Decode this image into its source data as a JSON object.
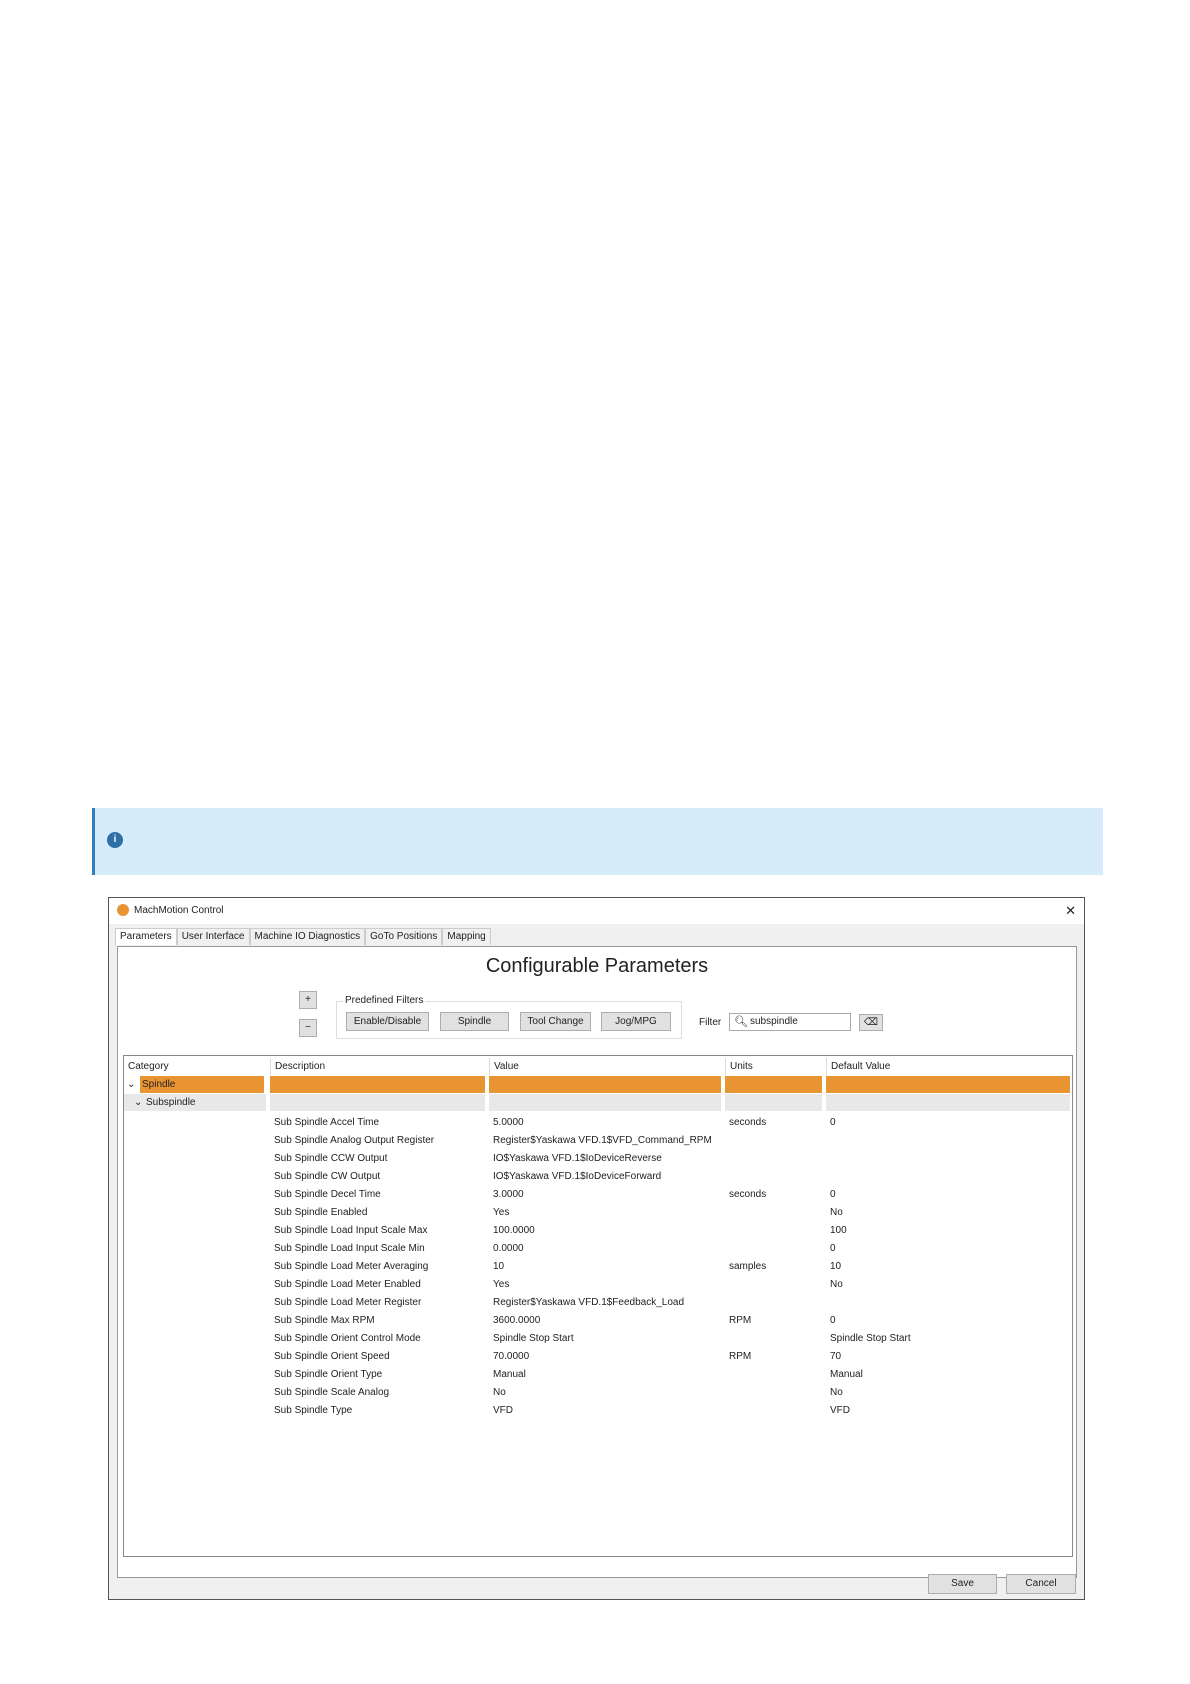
{
  "note": {
    "icon": "info-icon"
  },
  "window": {
    "title": "MachMotion Control",
    "close": "✕",
    "tabs": [
      "Parameters",
      "User Interface",
      "Machine IO Diagnostics",
      "GoTo Positions",
      "Mapping"
    ],
    "heading": "Configurable Parameters",
    "expand": "+",
    "collapse": "−",
    "filters_label": "Predefined Filters",
    "filters": [
      "Enable/Disable",
      "Spindle",
      "Tool Change",
      "Jog/MPG"
    ],
    "filter_label": "Filter",
    "filter_value": "subspindle",
    "columns": [
      "Category",
      "Description",
      "Value",
      "Units",
      "Default Value"
    ],
    "tree": {
      "category": "Spindle",
      "subcategory": "Subspindle"
    },
    "rows": [
      [
        "Sub Spindle Accel Time",
        "5.0000",
        "seconds",
        "0"
      ],
      [
        "Sub Spindle Analog Output Register",
        "Register$Yaskawa VFD.1$VFD_Command_RPM",
        "",
        ""
      ],
      [
        "Sub Spindle CCW Output",
        "IO$Yaskawa VFD.1$IoDeviceReverse",
        "",
        ""
      ],
      [
        "Sub Spindle CW Output",
        "IO$Yaskawa VFD.1$IoDeviceForward",
        "",
        ""
      ],
      [
        "Sub Spindle Decel Time",
        "3.0000",
        "seconds",
        "0"
      ],
      [
        "Sub Spindle Enabled",
        "Yes",
        "",
        "No"
      ],
      [
        "Sub Spindle Load Input Scale Max",
        "100.0000",
        "",
        "100"
      ],
      [
        "Sub Spindle Load Input Scale Min",
        "0.0000",
        "",
        "0"
      ],
      [
        "Sub Spindle Load Meter Averaging",
        "10",
        "samples",
        "10"
      ],
      [
        "Sub Spindle Load Meter Enabled",
        "Yes",
        "",
        "No"
      ],
      [
        "Sub Spindle Load Meter Register",
        "Register$Yaskawa VFD.1$Feedback_Load",
        "",
        ""
      ],
      [
        "Sub Spindle Max RPM",
        "3600.0000",
        "RPM",
        "0"
      ],
      [
        "Sub Spindle Orient Control Mode",
        "Spindle Stop Start",
        "",
        "Spindle Stop Start"
      ],
      [
        "Sub Spindle Orient Speed",
        "70.0000",
        "RPM",
        "70"
      ],
      [
        "Sub Spindle Orient Type",
        "Manual",
        "",
        "Manual"
      ],
      [
        "Sub Spindle Scale Analog",
        "No",
        "",
        "No"
      ],
      [
        "Sub Spindle Type",
        "VFD",
        "",
        "VFD"
      ]
    ],
    "save": "Save",
    "cancel": "Cancel"
  },
  "colors": {
    "selection": "#e99433",
    "note_bg": "#d6ecfb"
  }
}
